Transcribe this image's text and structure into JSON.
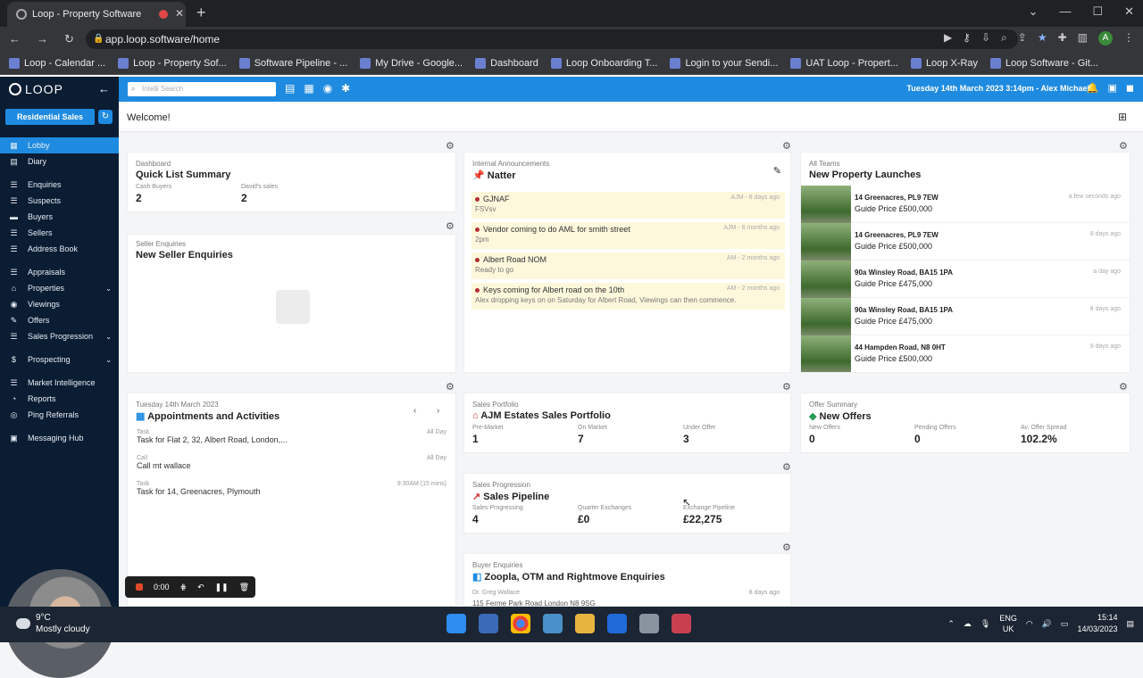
{
  "browser": {
    "tab_title": "Loop - Property Software",
    "url": "app.loop.software/home",
    "bookmarks": [
      "Loop - Calendar ...",
      "Loop - Property Sof...",
      "Software Pipeline - ...",
      "My Drive - Google...",
      "Dashboard",
      "Loop Onboarding T...",
      "Login to your Sendi...",
      "UAT Loop - Propert...",
      "Loop X-Ray",
      "Loop Software - Git..."
    ]
  },
  "app": {
    "logo": "LOOP",
    "department": "Residential Sales",
    "search_placeholder": "Intelli Search",
    "datetime": "Tuesday 14th March 2023 3:14pm - Alex Michael",
    "welcome": "Welcome!"
  },
  "menu": [
    {
      "label": "Lobby",
      "icon": "lobby-icon",
      "active": true
    },
    {
      "label": "Diary",
      "icon": "calendar-icon"
    },
    {
      "label": "Enquiries",
      "icon": "enquiries-icon"
    },
    {
      "label": "Suspects",
      "icon": "suspects-icon"
    },
    {
      "label": "Buyers",
      "icon": "buyers-icon"
    },
    {
      "label": "Sellers",
      "icon": "sellers-icon"
    },
    {
      "label": "Address Book",
      "icon": "address-book-icon"
    },
    {
      "label": "Appraisals",
      "icon": "appraisals-icon"
    },
    {
      "label": "Properties",
      "icon": "home-icon",
      "chevron": true
    },
    {
      "label": "Viewings",
      "icon": "eye-icon"
    },
    {
      "label": "Offers",
      "icon": "offers-icon"
    },
    {
      "label": "Sales Progression",
      "icon": "progression-icon",
      "chevron": true
    },
    {
      "label": "Prospecting",
      "icon": "dollar-icon",
      "chevron": true
    },
    {
      "label": "Market Intelligence",
      "icon": "market-icon"
    },
    {
      "label": "Reports",
      "icon": "reports-icon"
    },
    {
      "label": "Ping Referrals",
      "icon": "referrals-icon"
    },
    {
      "label": "Messaging Hub",
      "icon": "message-icon"
    }
  ],
  "quick_list": {
    "kicker": "Dashboard",
    "title": "Quick List Summary",
    "stats": [
      {
        "label": "Cash Buyers",
        "value": "2"
      },
      {
        "label": "David's sales",
        "value": "2"
      }
    ]
  },
  "seller_enquiries": {
    "kicker": "Seller Enquiries",
    "title": "New Seller Enquiries"
  },
  "natter": {
    "kicker": "Internal Announcements",
    "title": "Natter",
    "items": [
      {
        "title": "GJNAF",
        "sub": "FSVsv",
        "meta": "AJM - 8 days ago"
      },
      {
        "title": "Vendor coming to do AML for smith street",
        "sub": "2pm",
        "meta": "AJM - 6 months ago"
      },
      {
        "title": "Albert Road NOM",
        "sub": "Ready to go",
        "meta": "AM - 2 months ago"
      },
      {
        "title": "Keys coming for Albert road on the 10th",
        "sub": "Alex dropping keys on on Saturday for Albert Road, Viewings can then commence.",
        "meta": "AM - 2 months ago"
      }
    ]
  },
  "launches": {
    "kicker": "All Teams",
    "title": "New Property Launches",
    "items": [
      {
        "address": "14 Greenacres, PL9 7EW",
        "price": "Guide Price £500,000",
        "time": "a few seconds ago"
      },
      {
        "address": "14 Greenacres, PL9 7EW",
        "price": "Guide Price £500,000",
        "time": "8 days ago"
      },
      {
        "address": "90a Winsley Road, BA15 1PA",
        "price": "Guide Price £475,000",
        "time": "a day ago"
      },
      {
        "address": "90a Winsley Road, BA15 1PA",
        "price": "Guide Price £475,000",
        "time": "8 days ago"
      },
      {
        "address": "44 Hampden Road, N8 0HT",
        "price": "Guide Price £500,000",
        "time": "9 days ago"
      }
    ]
  },
  "appointments": {
    "kicker": "Tuesday 14th March 2023",
    "title": "Appointments and Activities",
    "items": [
      {
        "kind": "Task",
        "desc": "Task for Flat 2, 32, Albert Road, London,...",
        "right": "All Day"
      },
      {
        "kind": "Call",
        "desc": "Call mt wallace",
        "right": "All Day"
      },
      {
        "kind": "Task",
        "desc": "Task for 14, Greenacres, Plymouth",
        "right": "9:30AM (15 mins)"
      }
    ]
  },
  "portfolio": {
    "kicker": "Sales Portfolio",
    "title": "AJM Estates Sales Portfolio",
    "stats": [
      {
        "label": "Pre-Market",
        "value": "1"
      },
      {
        "label": "On Market",
        "value": "7"
      },
      {
        "label": "Under Offer",
        "value": "3"
      }
    ]
  },
  "offers": {
    "kicker": "Offer Summary",
    "title": "New Offers",
    "stats": [
      {
        "label": "New Offers",
        "value": "0"
      },
      {
        "label": "Pending Offers",
        "value": "0"
      },
      {
        "label": "Av. Offer Spread",
        "value": "102.2%"
      }
    ]
  },
  "pipeline": {
    "kicker": "Sales Progression",
    "title": "Sales Pipeline",
    "stats": [
      {
        "label": "Sales Progressing",
        "value": "4"
      },
      {
        "label": "Quarter Exchanges",
        "value": "£0"
      },
      {
        "label": "Exchange Pipeline",
        "value": "£22,275"
      }
    ]
  },
  "buyer_enquiries": {
    "kicker": "Buyer Enquiries",
    "title": "Zoopla, OTM and Rightmove Enquiries",
    "name": "Dr. Greg Wallace",
    "address": "115 Ferme Park Road London N8 9SG",
    "time": "8 days ago"
  },
  "recorder": {
    "time": "0:00"
  },
  "taskbar": {
    "temp": "9°C",
    "weather": "Mostly cloudy",
    "lang1": "ENG",
    "lang2": "UK",
    "time": "15:14",
    "date": "14/03/2023"
  }
}
